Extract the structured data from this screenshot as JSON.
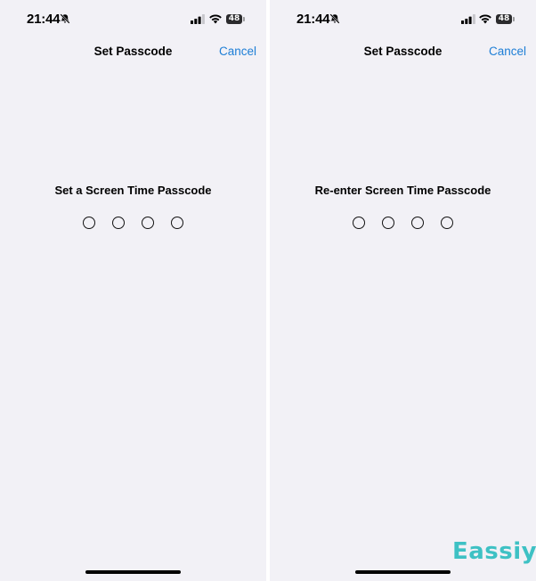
{
  "screens": [
    {
      "status": {
        "time": "21:44",
        "battery": "48"
      },
      "nav": {
        "title": "Set Passcode",
        "cancel": "Cancel"
      },
      "prompt": "Set a Screen Time Passcode",
      "passcode_length": 4,
      "entered_digits": 0
    },
    {
      "status": {
        "time": "21:44",
        "battery": "48"
      },
      "nav": {
        "title": "Set Passcode",
        "cancel": "Cancel"
      },
      "prompt": "Re-enter Screen Time Passcode",
      "passcode_length": 4,
      "entered_digits": 0
    }
  ],
  "watermark": "Eassiy",
  "colors": {
    "background": "#f2f1f6",
    "link": "#1d7ed6",
    "watermark": "#3ec1c4"
  },
  "icons": [
    "bell-slash-icon",
    "cellular-signal-icon",
    "wifi-icon",
    "battery-icon"
  ]
}
